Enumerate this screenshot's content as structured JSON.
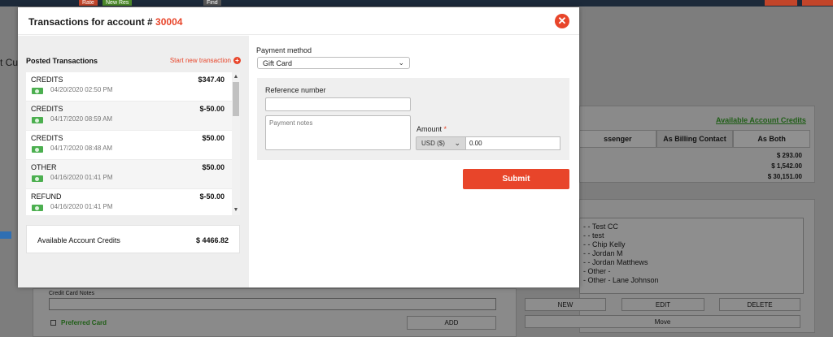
{
  "background": {
    "top_buttons": [
      "Rate",
      "New Res",
      "Find"
    ],
    "customer_label": "t Cus",
    "available_credits_link": "Available Account Credits",
    "role_tabs": [
      "ssenger",
      "As Billing Contact",
      "As Both"
    ],
    "amounts": [
      "$ 293.00",
      "$ 1,542.00",
      "$ 30,151.00"
    ],
    "contacts": [
      "- - Test CC",
      "- - test",
      "- - Chip Kelly",
      "- - Jordan M",
      "- - Jordan Matthews",
      "- Other -",
      "- Other - Lane Johnson"
    ],
    "list_buttons": [
      "NEW",
      "EDIT",
      "DELETE"
    ],
    "move_button": "Move",
    "cc_notes_label": "Credit Card Notes",
    "preferred_card_label": "Preferred Card",
    "add_button": "ADD"
  },
  "modal": {
    "title": "Transactions for account # ",
    "account_number": "30004",
    "close_icon": "close-circle-icon",
    "accent_color": "#e8452a",
    "posted": {
      "title": "Posted Transactions",
      "new_link": "Start new transaction",
      "transactions": [
        {
          "type": "CREDITS",
          "amount": "$347.40",
          "date": "04/20/2020 02:50 PM",
          "icon": "cash-icon"
        },
        {
          "type": "CREDITS",
          "amount": "$-50.00",
          "date": "04/17/2020 08:59 AM",
          "icon": "cash-icon"
        },
        {
          "type": "CREDITS",
          "amount": "$50.00",
          "date": "04/17/2020 08:48 AM",
          "icon": "cash-icon"
        },
        {
          "type": "OTHER",
          "amount": "$50.00",
          "date": "04/16/2020 01:41 PM",
          "icon": "cash-icon"
        },
        {
          "type": "REFUND",
          "amount": "$-50.00",
          "date": "04/16/2020 01:41 PM",
          "icon": "cash-icon"
        }
      ],
      "available_label": "Available Account Credits",
      "available_amount": "$ 4466.82"
    },
    "form": {
      "payment_method_label": "Payment method",
      "payment_method_value": "Gift Card",
      "reference_label": "Reference number",
      "reference_value": "",
      "notes_placeholder": "Payment notes",
      "amount_label": "Amount",
      "required_mark": "*",
      "currency": "USD ($)",
      "amount_value": "0.00",
      "submit_label": "Submit"
    }
  }
}
